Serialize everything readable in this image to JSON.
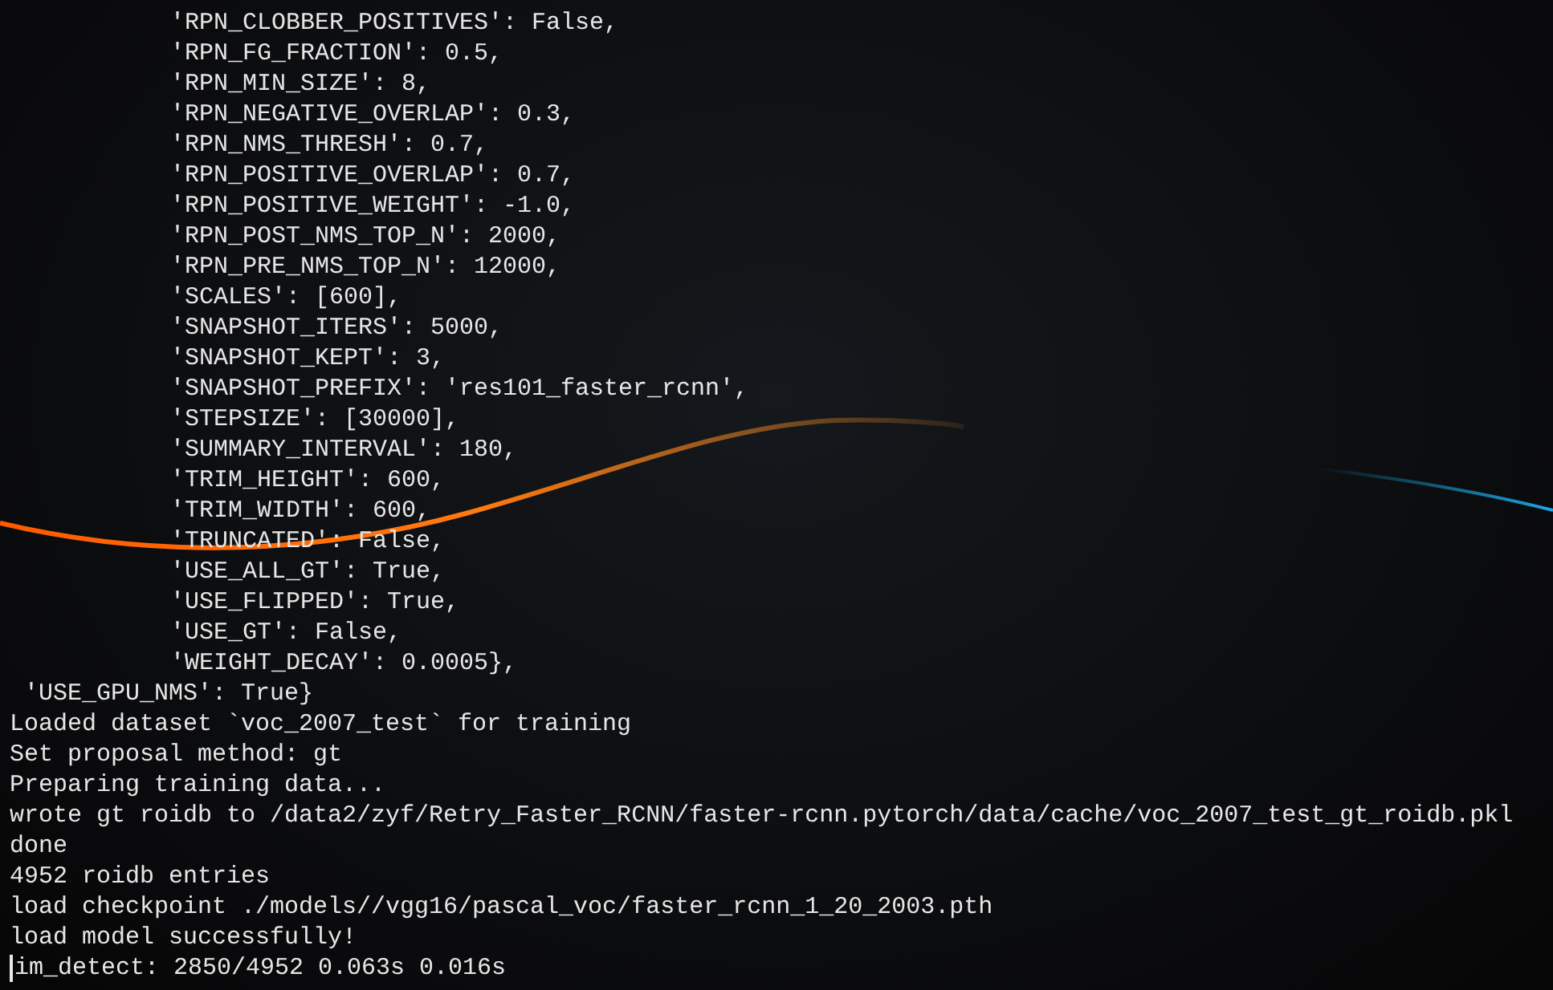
{
  "terminal": {
    "lines": [
      {
        "kind": "entry",
        "text": "'RPN_CLOBBER_POSITIVES': False,"
      },
      {
        "kind": "entry",
        "text": "'RPN_FG_FRACTION': 0.5,"
      },
      {
        "kind": "entry",
        "text": "'RPN_MIN_SIZE': 8,"
      },
      {
        "kind": "entry",
        "text": "'RPN_NEGATIVE_OVERLAP': 0.3,"
      },
      {
        "kind": "entry",
        "text": "'RPN_NMS_THRESH': 0.7,"
      },
      {
        "kind": "entry",
        "text": "'RPN_POSITIVE_OVERLAP': 0.7,"
      },
      {
        "kind": "entry",
        "text": "'RPN_POSITIVE_WEIGHT': -1.0,"
      },
      {
        "kind": "entry",
        "text": "'RPN_POST_NMS_TOP_N': 2000,"
      },
      {
        "kind": "entry",
        "text": "'RPN_PRE_NMS_TOP_N': 12000,"
      },
      {
        "kind": "entry",
        "text": "'SCALES': [600],"
      },
      {
        "kind": "entry",
        "text": "'SNAPSHOT_ITERS': 5000,"
      },
      {
        "kind": "entry",
        "text": "'SNAPSHOT_KEPT': 3,"
      },
      {
        "kind": "entry",
        "text": "'SNAPSHOT_PREFIX': 'res101_faster_rcnn',"
      },
      {
        "kind": "entry",
        "text": "'STEPSIZE': [30000],"
      },
      {
        "kind": "entry",
        "text": "'SUMMARY_INTERVAL': 180,"
      },
      {
        "kind": "entry",
        "text": "'TRIM_HEIGHT': 600,"
      },
      {
        "kind": "entry",
        "text": "'TRIM_WIDTH': 600,"
      },
      {
        "kind": "entry",
        "text": "'TRUNCATED': False,"
      },
      {
        "kind": "entry",
        "text": "'USE_ALL_GT': True,"
      },
      {
        "kind": "entry",
        "text": "'USE_FLIPPED': True,"
      },
      {
        "kind": "entry",
        "text": "'USE_GT': False,"
      },
      {
        "kind": "entry",
        "text": "'WEIGHT_DECAY': 0.0005},"
      },
      {
        "kind": "key",
        "text": "'USE_GPU_NMS': True}"
      },
      {
        "kind": "output",
        "text": "Loaded dataset `voc_2007_test` for training"
      },
      {
        "kind": "output",
        "text": "Set proposal method: gt"
      },
      {
        "kind": "output",
        "text": "Preparing training data..."
      },
      {
        "kind": "output",
        "text": "wrote gt roidb to /data2/zyf/Retry_Faster_RCNN/faster-rcnn.pytorch/data/cache/voc_2007_test_gt_roidb.pkl"
      },
      {
        "kind": "output",
        "text": "done"
      },
      {
        "kind": "output",
        "text": "4952 roidb entries"
      },
      {
        "kind": "output",
        "text": "load checkpoint ./models//vgg16/pascal_voc/faster_rcnn_1_20_2003.pth"
      },
      {
        "kind": "output",
        "text": "load model successfully!"
      },
      {
        "kind": "prompt",
        "text": "im_detect: 2850/4952 0.063s 0.016s"
      }
    ]
  }
}
